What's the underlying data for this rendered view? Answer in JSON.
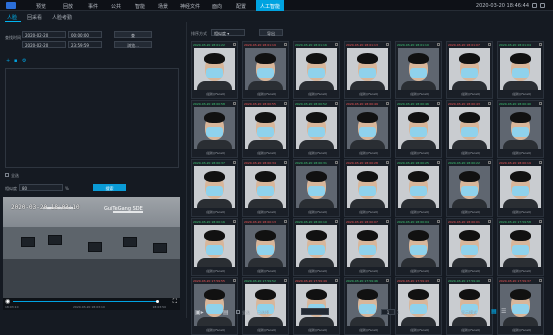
{
  "topbar": {
    "nav": [
      "预览",
      "回放",
      "事件",
      "公共",
      "智能",
      "场景",
      "神经文件",
      "面向",
      "配置",
      "人工智能"
    ],
    "active": "人工智能",
    "datetime": "2020-03-20 18:46:44"
  },
  "tabs": [
    "人脸",
    "回采看",
    "人脸考勤"
  ],
  "active_tab": "人脸",
  "filter": {
    "time_label": "查找时间",
    "start_date": "2020-02-20",
    "start_time": "00:00:00",
    "end_date": "2020-02-20",
    "end_time": "23:59:59",
    "query_btn": "查",
    "browse_btn": "浏览...",
    "checkbox_label": "全选",
    "similarity_label": "相似度",
    "similarity_value": "80",
    "similarity_unit": "%",
    "search_btn": "搜索"
  },
  "video": {
    "timestamp": "2020-03-20 18:03:10",
    "title": "GuiTeGang SDE",
    "time_left": "18:03:10",
    "time_center": "2020-03-20 18:03:10",
    "time_right": "18:03:50"
  },
  "right": {
    "sort_label": "排序方式",
    "sort_value": "相似度",
    "export_btn": "导出",
    "select_all": "全选",
    "result_label": "已选择",
    "page_current": "1",
    "page_total": "1",
    "view_label": "显示模式"
  },
  "cards": [
    {
      "head": "2020-03-20 18:01:22",
      "color": "green",
      "name": "(最新)(Face0)"
    },
    {
      "head": "2020-03-20 18:01:19",
      "color": "red",
      "name": "(最新)(Face0)"
    },
    {
      "head": "2020-03-20 18:01:16",
      "color": "green",
      "name": "(最新)(Face0)"
    },
    {
      "head": "2020-03-20 18:01:13",
      "color": "red",
      "name": "(最新)(Face0)"
    },
    {
      "head": "2020-03-20 18:01:10",
      "color": "green",
      "name": "(最新)(Face0)"
    },
    {
      "head": "2020-03-20 18:01:07",
      "color": "red",
      "name": "(最新)(Face0)"
    },
    {
      "head": "2020-03-20 18:01:04",
      "color": "green",
      "name": "(最新)(Face0)"
    },
    {
      "head": "2020-03-20 18:00:58",
      "color": "green",
      "name": "(最新)(Face0)"
    },
    {
      "head": "2020-03-20 18:00:55",
      "color": "red",
      "name": "(最新)(Face0)"
    },
    {
      "head": "2020-03-20 18:00:52",
      "color": "green",
      "name": "(最新)(Face0)"
    },
    {
      "head": "2020-03-20 18:00:49",
      "color": "red",
      "name": "(最新)(Face0)"
    },
    {
      "head": "2020-03-20 18:00:46",
      "color": "green",
      "name": "(最新)(Face0)"
    },
    {
      "head": "2020-03-20 18:00:43",
      "color": "red",
      "name": "(最新)(Face0)"
    },
    {
      "head": "2020-03-20 18:00:40",
      "color": "green",
      "name": "(最新)(Face0)"
    },
    {
      "head": "2020-03-20 18:00:37",
      "color": "green",
      "name": "(最新)(Face0)"
    },
    {
      "head": "2020-03-20 18:00:34",
      "color": "red",
      "name": "(最新)(Face0)"
    },
    {
      "head": "2020-03-20 18:00:31",
      "color": "green",
      "name": "(最新)(Face0)"
    },
    {
      "head": "2020-03-20 18:00:28",
      "color": "red",
      "name": "(最新)(Face0)"
    },
    {
      "head": "2020-03-20 18:00:25",
      "color": "green",
      "name": "(最新)(Face0)"
    },
    {
      "head": "2020-03-20 18:00:22",
      "color": "green",
      "name": "(最新)(Face0)"
    },
    {
      "head": "2020-03-20 18:00:19",
      "color": "red",
      "name": "(最新)(Face0)"
    },
    {
      "head": "2020-03-20 18:00:16",
      "color": "green",
      "name": "(最新)(Face0)"
    },
    {
      "head": "2020-03-20 18:00:13",
      "color": "red",
      "name": "(最新)(Face0)"
    },
    {
      "head": "2020-03-20 18:00:10",
      "color": "green",
      "name": "(最新)(Face0)"
    },
    {
      "head": "2020-03-20 18:00:07",
      "color": "red",
      "name": "(最新)(Face0)"
    },
    {
      "head": "2020-03-20 18:00:04",
      "color": "green",
      "name": "(最新)(Face0)"
    },
    {
      "head": "2020-03-20 18:00:01",
      "color": "red",
      "name": "(最新)(Face0)"
    },
    {
      "head": "2020-03-20 17:59:58",
      "color": "green",
      "name": "(最新)(Face0)"
    },
    {
      "head": "2020-03-20 17:59:55",
      "color": "red",
      "name": "(最新)(Face0)"
    },
    {
      "head": "2020-03-20 17:59:52",
      "color": "green",
      "name": "(最新)(Face0)"
    },
    {
      "head": "2020-03-20 17:59:49",
      "color": "red",
      "name": "(最新)(Face0)"
    },
    {
      "head": "2020-03-20 17:59:46",
      "color": "green",
      "name": "(最新)(Face0)"
    },
    {
      "head": "2020-03-20 17:59:43",
      "color": "red",
      "name": "(最新)(Face0)"
    },
    {
      "head": "2020-03-20 17:59:40",
      "color": "green",
      "name": "(最新)(Face0)"
    },
    {
      "head": "2020-03-20 17:59:37",
      "color": "red",
      "name": "(最新)(Face0)"
    }
  ]
}
